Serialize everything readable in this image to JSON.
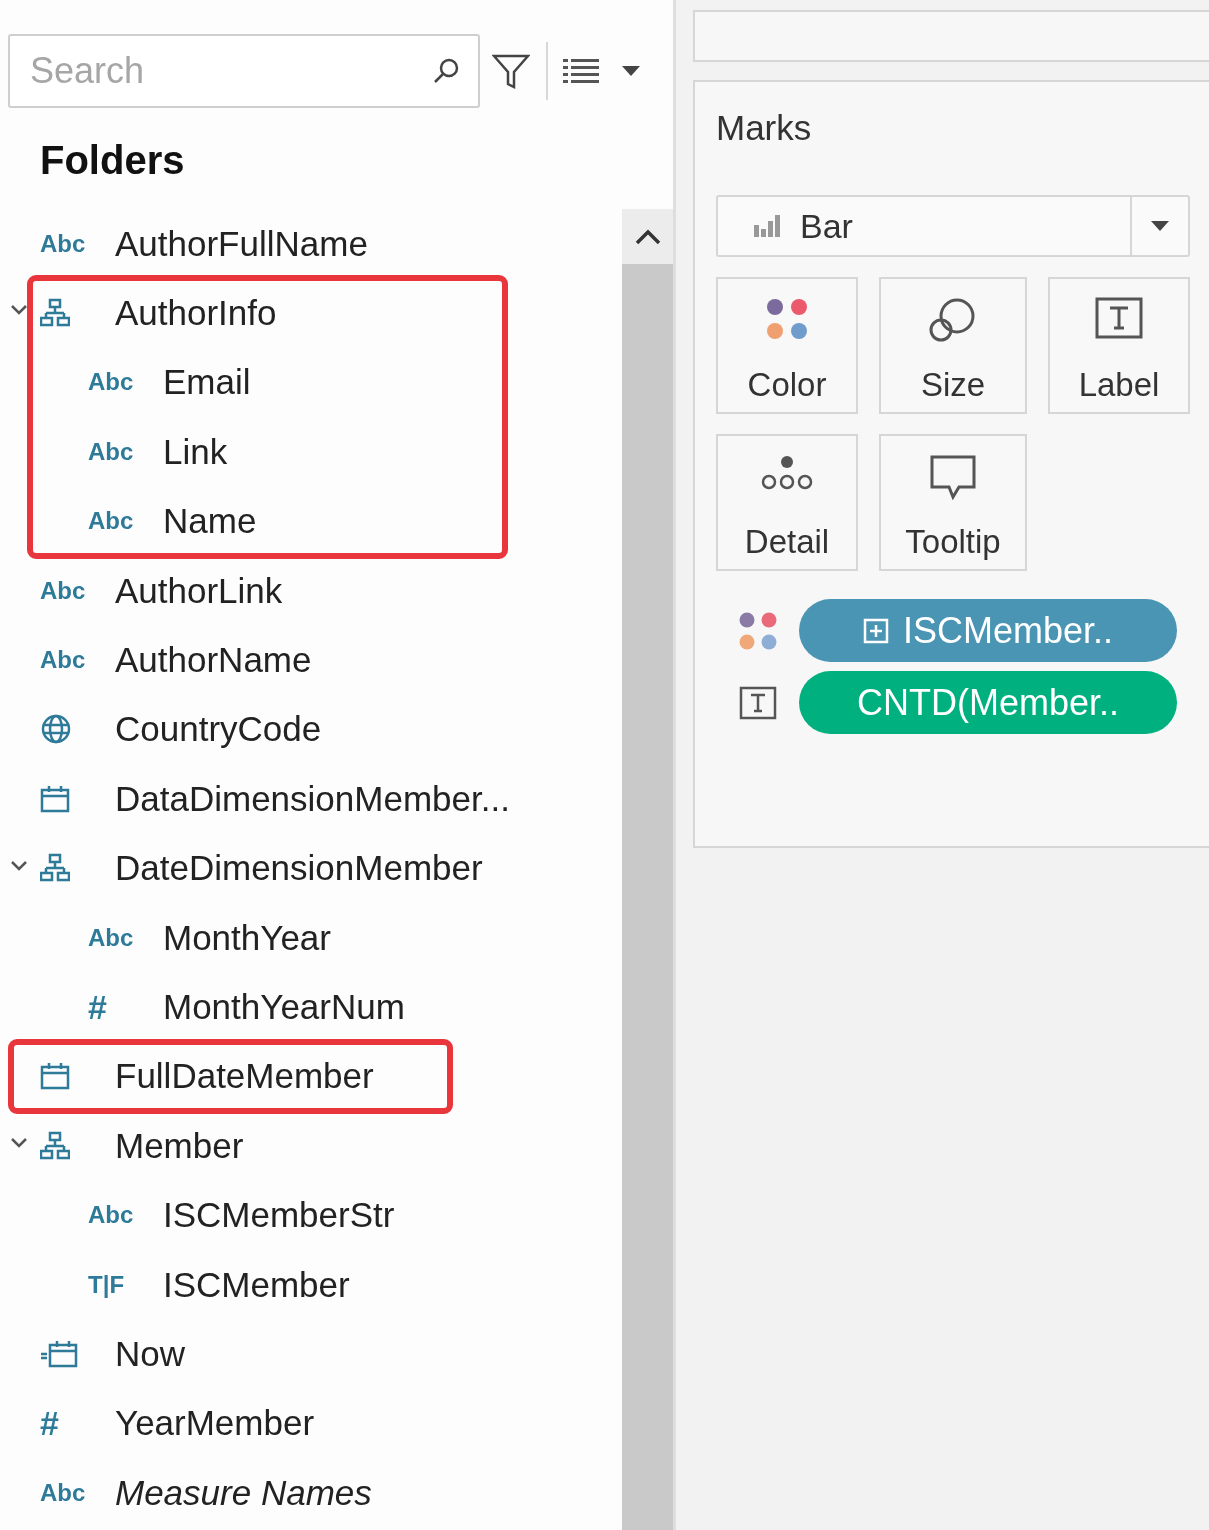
{
  "toolbar": {
    "search": {
      "placeholder": "Search"
    }
  },
  "data_pane": {
    "heading": "Folders",
    "fields": [
      {
        "name": "AuthorFullName",
        "kind": "string",
        "icon_label": "Abc"
      },
      {
        "name": "AuthorInfo",
        "kind": "hierarchy",
        "expanded": true,
        "highlighted": true,
        "children": [
          {
            "name": "Email",
            "kind": "string",
            "icon_label": "Abc"
          },
          {
            "name": "Link",
            "kind": "string",
            "icon_label": "Abc"
          },
          {
            "name": "Name",
            "kind": "string",
            "icon_label": "Abc"
          }
        ]
      },
      {
        "name": "AuthorLink",
        "kind": "string",
        "icon_label": "Abc"
      },
      {
        "name": "AuthorName",
        "kind": "string",
        "icon_label": "Abc"
      },
      {
        "name": "CountryCode",
        "kind": "geo"
      },
      {
        "name": "DataDimensionMember...",
        "kind": "date"
      },
      {
        "name": "DateDimensionMember",
        "kind": "hierarchy",
        "expanded": true,
        "children": [
          {
            "name": "MonthYear",
            "kind": "string",
            "icon_label": "Abc"
          },
          {
            "name": "MonthYearNum",
            "kind": "number",
            "icon_label": "#"
          }
        ]
      },
      {
        "name": "FullDateMember",
        "kind": "date",
        "highlighted": true
      },
      {
        "name": "Member",
        "kind": "hierarchy",
        "expanded": true,
        "children": [
          {
            "name": "ISCMemberStr",
            "kind": "string",
            "icon_label": "Abc"
          },
          {
            "name": "ISCMember",
            "kind": "boolean",
            "icon_label": "T|F"
          }
        ]
      },
      {
        "name": "Now",
        "kind": "calcdate"
      },
      {
        "name": "YearMember",
        "kind": "number",
        "icon_label": "#"
      },
      {
        "name": "Measure Names",
        "kind": "string",
        "icon_label": "Abc",
        "italic": true
      }
    ]
  },
  "marks": {
    "title": "Marks",
    "mark_type": "Bar",
    "cards": [
      {
        "kind": "color",
        "label": "Color"
      },
      {
        "kind": "size",
        "label": "Size"
      },
      {
        "kind": "label",
        "label": "Label"
      },
      {
        "kind": "detail",
        "label": "Detail"
      },
      {
        "kind": "tooltip",
        "label": "Tooltip"
      }
    ],
    "pills": [
      {
        "kind": "color",
        "text": "ISCMember..",
        "color": "#4a95b3",
        "expandable": true
      },
      {
        "kind": "label",
        "text": "CNTD(Member..",
        "color": "#00b07f",
        "expandable": false
      }
    ]
  }
}
